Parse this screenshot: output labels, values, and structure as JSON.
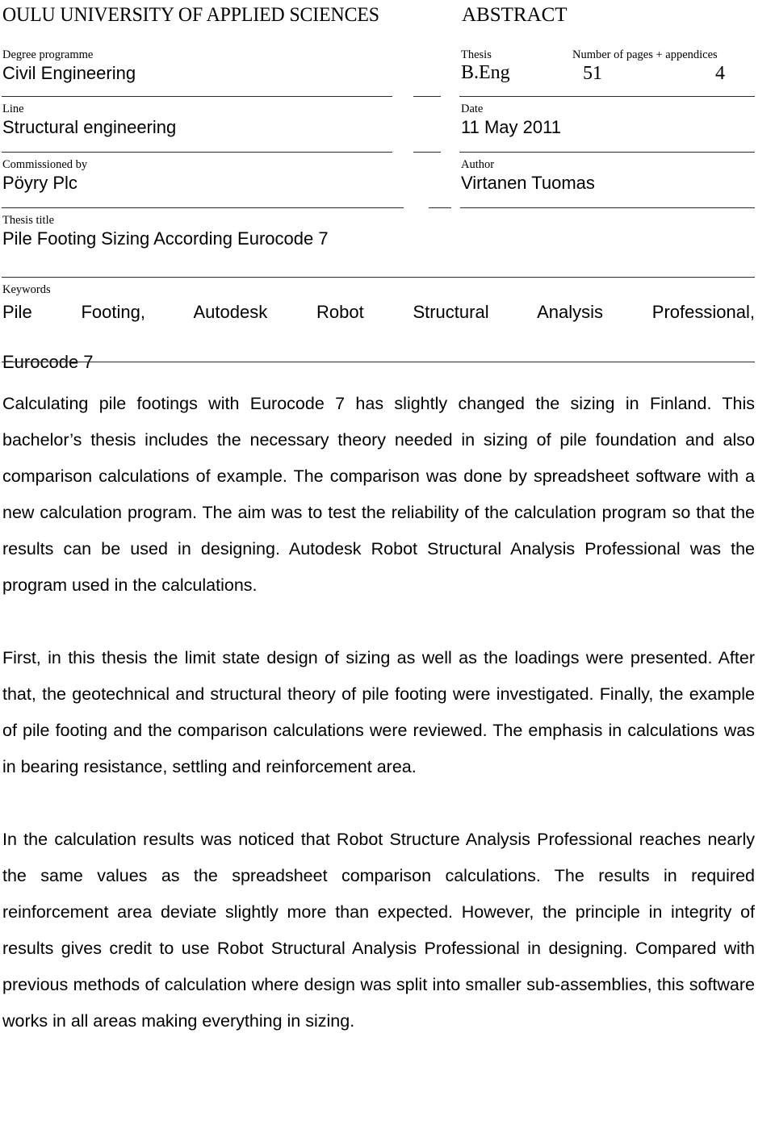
{
  "header": {
    "organization": "OULU UNIVERSITY OF APPLIED SCIENCES",
    "document_type": "ABSTRACT"
  },
  "metadata": {
    "degree_programme": {
      "label": "Degree programme",
      "value": "Civil Engineering"
    },
    "thesis": {
      "label": "Thesis",
      "value": "B.Eng"
    },
    "pages": {
      "label": "Number of pages + appendices",
      "pages_value": "51",
      "appendices_value": "4"
    },
    "line": {
      "label": "Line",
      "value": "Structural engineering"
    },
    "date": {
      "label": "Date",
      "value": "11 May 2011"
    },
    "commissioned_by": {
      "label": "Commissioned by",
      "value": "Pöyry Plc"
    },
    "author": {
      "label": "Author",
      "value": "Virtanen Tuomas"
    },
    "thesis_title": {
      "label": "Thesis title",
      "value": "Pile Footing Sizing According Eurocode 7"
    },
    "keywords": {
      "label": "Keywords",
      "line1": "Pile  Footing,  Autodesk  Robot  Structural  Analysis  Professional,",
      "line2": "Eurocode 7"
    }
  },
  "abstract": {
    "paragraphs": [
      "Calculating pile footings with Eurocode 7 has slightly changed the sizing in Finland. This bachelor’s thesis includes the necessary theory needed in sizing of pile foundation and also comparison calculations of example. The comparison was done by spreadsheet software with a new calculation program. The aim was to test the reliability of the calculation program so that the results can be used in designing. Autodesk Robot Structural Analysis Professional was the program used in the calculations.",
      "First, in this thesis the limit state design of sizing as well as the loadings were presented. After that, the geotechnical and structural theory of pile footing were investigated. Finally, the example of pile footing and the comparison calculations were reviewed. The emphasis in calculations was in bearing resistance, settling and reinforcement area.",
      "In the calculation results was noticed that Robot Structure Analysis Professional reaches nearly the same values as the spreadsheet comparison calculations. The results in required reinforcement area deviate slightly more than expected. However, the principle in integrity of results gives credit to use Robot Structural Analysis Professional in designing. Compared with previous methods of calculation where design was split into smaller sub-assemblies, this software works in all areas making everything in sizing."
    ]
  },
  "colors": {
    "text": "#000000",
    "rule": "#2b2b2b",
    "background": "#ffffff"
  }
}
